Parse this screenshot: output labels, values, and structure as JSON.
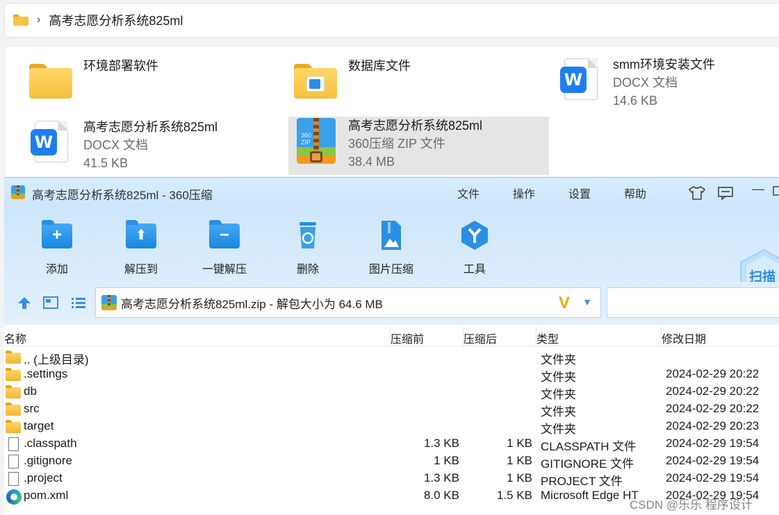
{
  "explorer": {
    "breadcrumb": "高考志愿分析系统825ml",
    "files": [
      {
        "name": "环境部署软件",
        "type": "",
        "size": "",
        "icon": "folder-icon"
      },
      {
        "name": "数据库文件",
        "type": "",
        "size": "",
        "icon": "folder-icon"
      },
      {
        "name": "smm环境安装文件",
        "type": "DOCX 文档",
        "size": "14.6 KB",
        "icon": "wps-doc-icon"
      },
      {
        "name": "高考志愿分析系统825ml",
        "type": "DOCX 文档",
        "size": "41.5 KB",
        "icon": "wps-doc-icon"
      },
      {
        "name": "高考志愿分析系统825ml",
        "type": "360压缩 ZIP 文件",
        "size": "38.4 MB",
        "icon": "zip-archive-icon"
      }
    ]
  },
  "zipwin": {
    "title": "高考志愿分析系统825ml - 360压缩",
    "menu": [
      "文件",
      "操作",
      "设置",
      "帮助"
    ],
    "tools": [
      {
        "label": "添加",
        "icon": "add-icon"
      },
      {
        "label": "解压到",
        "icon": "extract-to-icon"
      },
      {
        "label": "一键解压",
        "icon": "one-click-extract-icon"
      },
      {
        "label": "删除",
        "icon": "delete-icon"
      },
      {
        "label": "图片压缩",
        "icon": "image-compress-icon"
      },
      {
        "label": "工具",
        "icon": "tools-icon"
      }
    ],
    "scan_label": "扫描",
    "archive_path": "高考志愿分析系统825ml.zip - 解包大小为 64.6 MB",
    "columns": [
      "名称",
      "压缩前",
      "压缩后",
      "类型",
      "修改日期"
    ],
    "rows": [
      {
        "name": ".. (上级目录)",
        "before": "",
        "after": "",
        "type": "文件夹",
        "date": "",
        "icon": "folder"
      },
      {
        "name": ".settings",
        "before": "",
        "after": "",
        "type": "文件夹",
        "date": "2024-02-29 20:22",
        "icon": "folder"
      },
      {
        "name": "db",
        "before": "",
        "after": "",
        "type": "文件夹",
        "date": "2024-02-29 20:22",
        "icon": "folder"
      },
      {
        "name": "src",
        "before": "",
        "after": "",
        "type": "文件夹",
        "date": "2024-02-29 20:22",
        "icon": "folder"
      },
      {
        "name": "target",
        "before": "",
        "after": "",
        "type": "文件夹",
        "date": "2024-02-29 20:23",
        "icon": "folder"
      },
      {
        "name": ".classpath",
        "before": "1.3 KB",
        "after": "1 KB",
        "type": "CLASSPATH 文件",
        "date": "2024-02-29 19:54",
        "icon": "file"
      },
      {
        "name": ".gitignore",
        "before": "1 KB",
        "after": "1 KB",
        "type": "GITIGNORE 文件",
        "date": "2024-02-29 19:54",
        "icon": "file"
      },
      {
        "name": ".project",
        "before": "1.3 KB",
        "after": "1 KB",
        "type": "PROJECT 文件",
        "date": "2024-02-29 19:54",
        "icon": "file"
      },
      {
        "name": "pom.xml",
        "before": "8.0 KB",
        "after": "1.5 KB",
        "type": "Microsoft Edge HT",
        "date": "2024-02-29 19:54",
        "icon": "edge"
      }
    ]
  },
  "watermark": "CSDN @乐乐 程序设计",
  "colors": {
    "accent": "#1e7ef0",
    "toolbar_bg": "#cde6fd",
    "selection": "#e5e5e5"
  }
}
